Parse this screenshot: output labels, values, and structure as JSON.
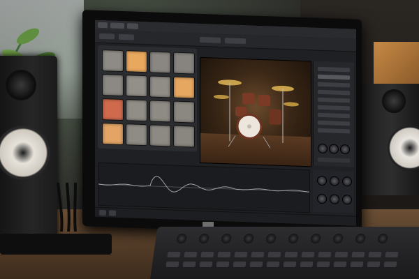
{
  "scene": {
    "description_type": "photo",
    "accent_colors": {
      "pad_orange": "#e3a258",
      "pad_red": "#d86b4e",
      "pad_gray": "#8a8681",
      "wood": "#8a5a2a"
    }
  },
  "daw": {
    "pads": [
      {
        "color": "#8e8b86"
      },
      {
        "color": "#e8a85e"
      },
      {
        "color": "#8a8782"
      },
      {
        "color": "#878480"
      },
      {
        "color": "#8c8984"
      },
      {
        "color": "#938f89"
      },
      {
        "color": "#908c86"
      },
      {
        "color": "#e6a761"
      },
      {
        "color": "#d06a4d"
      },
      {
        "color": "#918d87"
      },
      {
        "color": "#8e8a84"
      },
      {
        "color": "#8b8781"
      },
      {
        "color": "#e3a466"
      },
      {
        "color": "#8f8b85"
      },
      {
        "color": "#8d8983"
      },
      {
        "color": "#8a8680"
      }
    ],
    "side_list_rows": 9,
    "active_row": 1,
    "icons": {
      "video_preview": "drum-kit-image-icon",
      "waveform": "waveform-icon",
      "knobs": "knob-icon"
    }
  }
}
